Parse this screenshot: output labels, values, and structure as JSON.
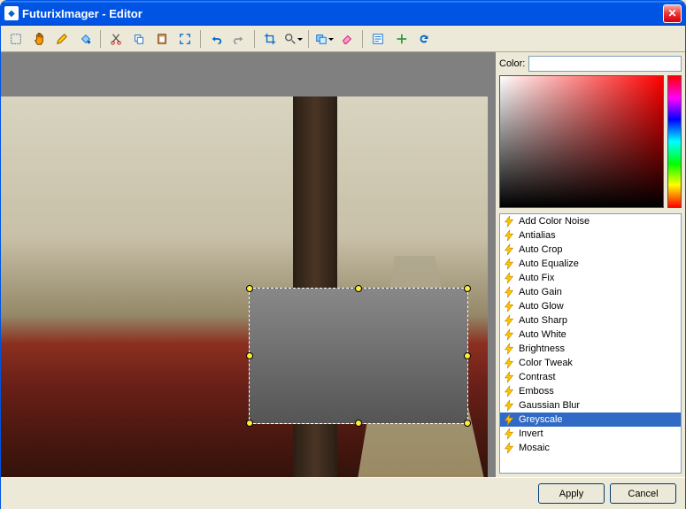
{
  "window": {
    "title": "FuturixImager - Editor"
  },
  "toolbar": {
    "icons": [
      "selection",
      "hand",
      "pencil",
      "bucket",
      "cut",
      "copy",
      "paste",
      "fit",
      "undo",
      "redo",
      "crop",
      "zoom",
      "layers",
      "clear",
      "props",
      "add",
      "refresh"
    ]
  },
  "color": {
    "label": "Color:",
    "value": "#ffffff"
  },
  "filters": {
    "items": [
      "Add Color Noise",
      "Antialias",
      "Auto Crop",
      "Auto Equalize",
      "Auto Fix",
      "Auto Gain",
      "Auto Glow",
      "Auto Sharp",
      "Auto White",
      "Brightness",
      "Color Tweak",
      "Contrast",
      "Emboss",
      "Gaussian Blur",
      "Greyscale",
      "Invert",
      "Mosaic"
    ],
    "selected": 14
  },
  "buttons": {
    "apply": "Apply",
    "cancel": "Cancel"
  }
}
